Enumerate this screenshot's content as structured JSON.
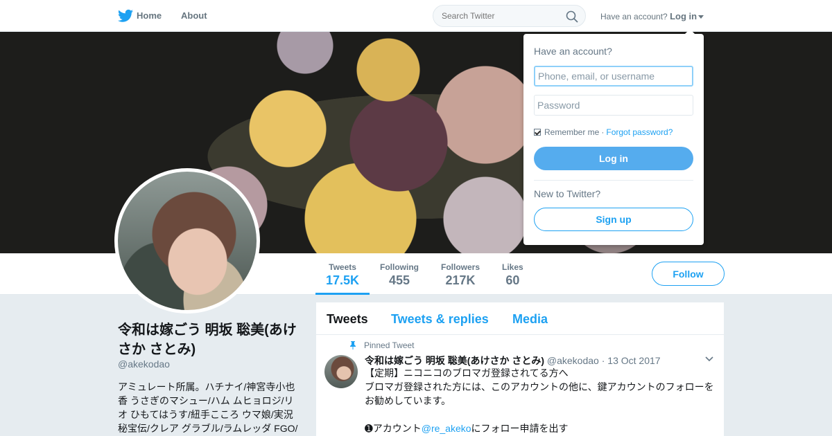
{
  "nav": {
    "logo_icon": "twitter-bird-icon",
    "home_label": "Home",
    "about_label": "About",
    "search_placeholder": "Search Twitter",
    "have_account_text": "Have an account?",
    "login_label": "Log in",
    "brand_color": "#1da1f2"
  },
  "profile": {
    "name": "令和は嫁ごう 明坂 聡美(あけさか さとみ)",
    "handle": "@akekodao",
    "bio": "アミュレート所属。ハチナイ/神宮寺小也香 うさぎのマシュー/ハム ムヒョロジ/リオ ひもてはうす/紐手こころ ウマ娘/実況 秘宝伝/クレア グラブル/ラムレッダ FGO/"
  },
  "stats": [
    {
      "label": "Tweets",
      "value": "17.5K",
      "active": true
    },
    {
      "label": "Following",
      "value": "455",
      "active": false
    },
    {
      "label": "Followers",
      "value": "217K",
      "active": false
    },
    {
      "label": "Likes",
      "value": "60",
      "active": false
    }
  ],
  "follow_label": "Follow",
  "timeline": {
    "tabs": [
      {
        "label": "Tweets",
        "active": true
      },
      {
        "label": "Tweets & replies",
        "active": false
      },
      {
        "label": "Media",
        "active": false
      }
    ],
    "pinned_label": "Pinned Tweet",
    "tweet": {
      "author": "令和は嫁ごう 明坂 聡美(あけさか さとみ)",
      "handle": "@akekodao",
      "separator": "·",
      "date": "13 Oct 2017",
      "line1": "【定期】ニコニコのブロマガ登録されてる方へ",
      "line2": "ブロマガ登録された方には、このアカウントの他に、鍵アカウントのフォローをお勧めしています。",
      "line4_prefix": "➊アカウント",
      "line4_mention": "@re_akeko",
      "line4_suffix": "にフォロー申請を出す"
    }
  },
  "login_dropdown": {
    "title": "Have an account?",
    "username_placeholder": "Phone, email, or username",
    "password_placeholder": "Password",
    "remember_label": "Remember me",
    "separator": "·",
    "forgot_label": "Forgot password?",
    "login_button": "Log in",
    "new_label": "New to Twitter?",
    "signup_button": "Sign up"
  }
}
